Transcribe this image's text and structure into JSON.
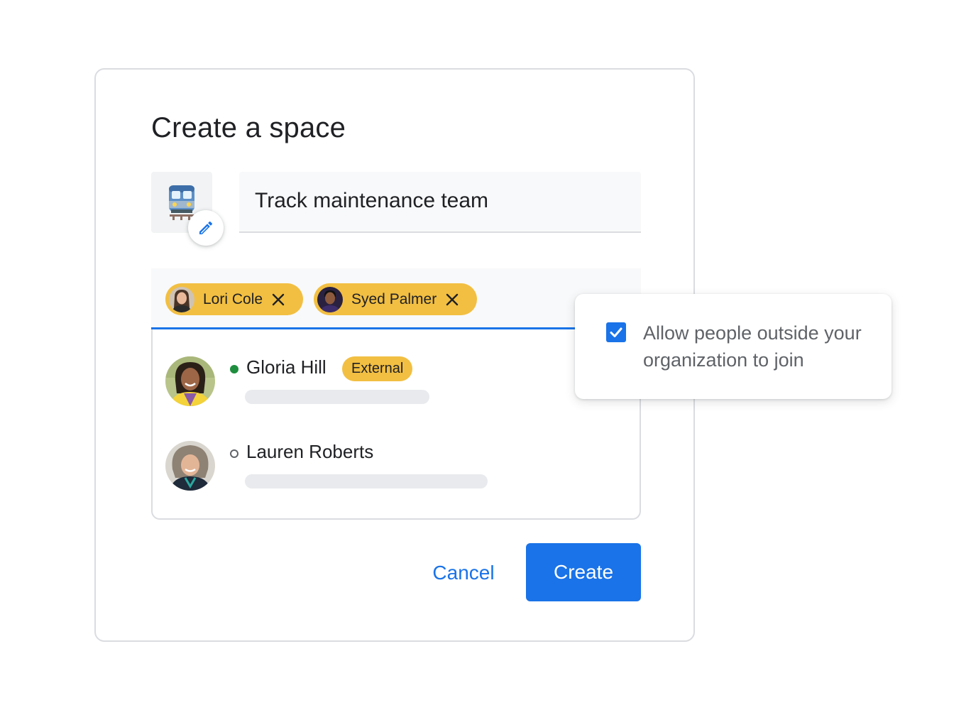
{
  "dialog": {
    "title": "Create a space",
    "space_emoji": "train-emoji",
    "space_name": "Track maintenance team",
    "edit_icon": "pencil-icon"
  },
  "people_field": {
    "chips": [
      {
        "label": "Lori Cole",
        "close_icon": "close-icon"
      },
      {
        "label": "Syed Palmer",
        "close_icon": "close-icon"
      }
    ]
  },
  "suggestions": [
    {
      "name": "Gloria Hill",
      "status": "online",
      "badge": "External"
    },
    {
      "name": "Lauren Roberts",
      "status": "offline",
      "badge": ""
    }
  ],
  "actions": {
    "cancel_label": "Cancel",
    "create_label": "Create"
  },
  "popover": {
    "checked": true,
    "label": "Allow people outside your organization to join"
  },
  "colors": {
    "accent": "#1a73e8",
    "chip": "#f2bf42",
    "online": "#1e8e3e",
    "border": "#dadce0"
  }
}
